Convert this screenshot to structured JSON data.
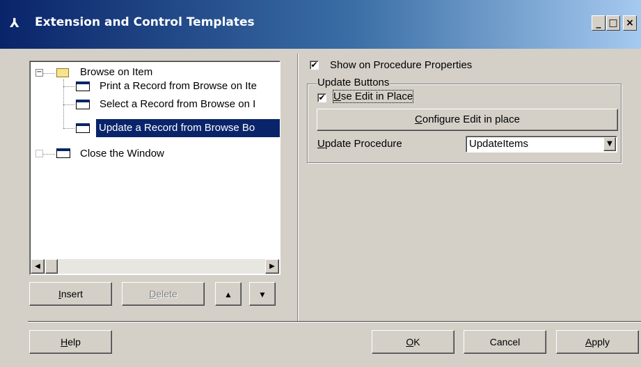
{
  "window": {
    "title": "Extension and Control Templates",
    "icon": "app-icon",
    "controls": {
      "minimize": "_",
      "maximize": "□",
      "close": "×"
    }
  },
  "tree": {
    "items": [
      {
        "label": "Browse on Item",
        "expander": "−",
        "icon": "folder-icon",
        "level": 0
      },
      {
        "label": "Print a Record from Browse on Ite",
        "icon": "window-icon",
        "level": 1
      },
      {
        "label": "Select a Record from Browse on I",
        "icon": "window-icon",
        "level": 1
      },
      {
        "label": "Update a Record from Browse Bo",
        "icon": "window-icon",
        "level": 1,
        "selected": true
      },
      {
        "label": "Close the Window",
        "icon": "window-icon",
        "level": 0
      }
    ]
  },
  "tree_buttons": {
    "insert_prefix": "",
    "insert_u": "I",
    "insert_rest": "nsert",
    "delete_u": "D",
    "delete_rest": "elete",
    "move_up_icon": "move-up-icon",
    "move_down_icon": "move-down-icon"
  },
  "settings": {
    "show_on_properties": {
      "label": "Show on Procedure Properties",
      "checked": true,
      "mark": "✔"
    },
    "group_title": "Update Buttons",
    "use_edit_in_place": {
      "u": "U",
      "rest": "se Edit in Place",
      "checked": true,
      "mark": "✔"
    },
    "configure_button": {
      "u": "C",
      "rest": "onfigure Edit in place"
    },
    "update_procedure": {
      "u": "U",
      "rest": "pdate Procedure",
      "value": "UpdateItems",
      "arrow": "▼"
    }
  },
  "footer": {
    "help_u": "H",
    "help_rest": "elp",
    "ok_u": "O",
    "ok_rest": "K",
    "cancel": "Cancel",
    "apply_u": "A",
    "apply_rest": "pply"
  },
  "colors": {
    "face": "#d4d0c8",
    "title_start": "#0a246a",
    "title_end": "#a6caf0",
    "selection": "#0a246a"
  }
}
